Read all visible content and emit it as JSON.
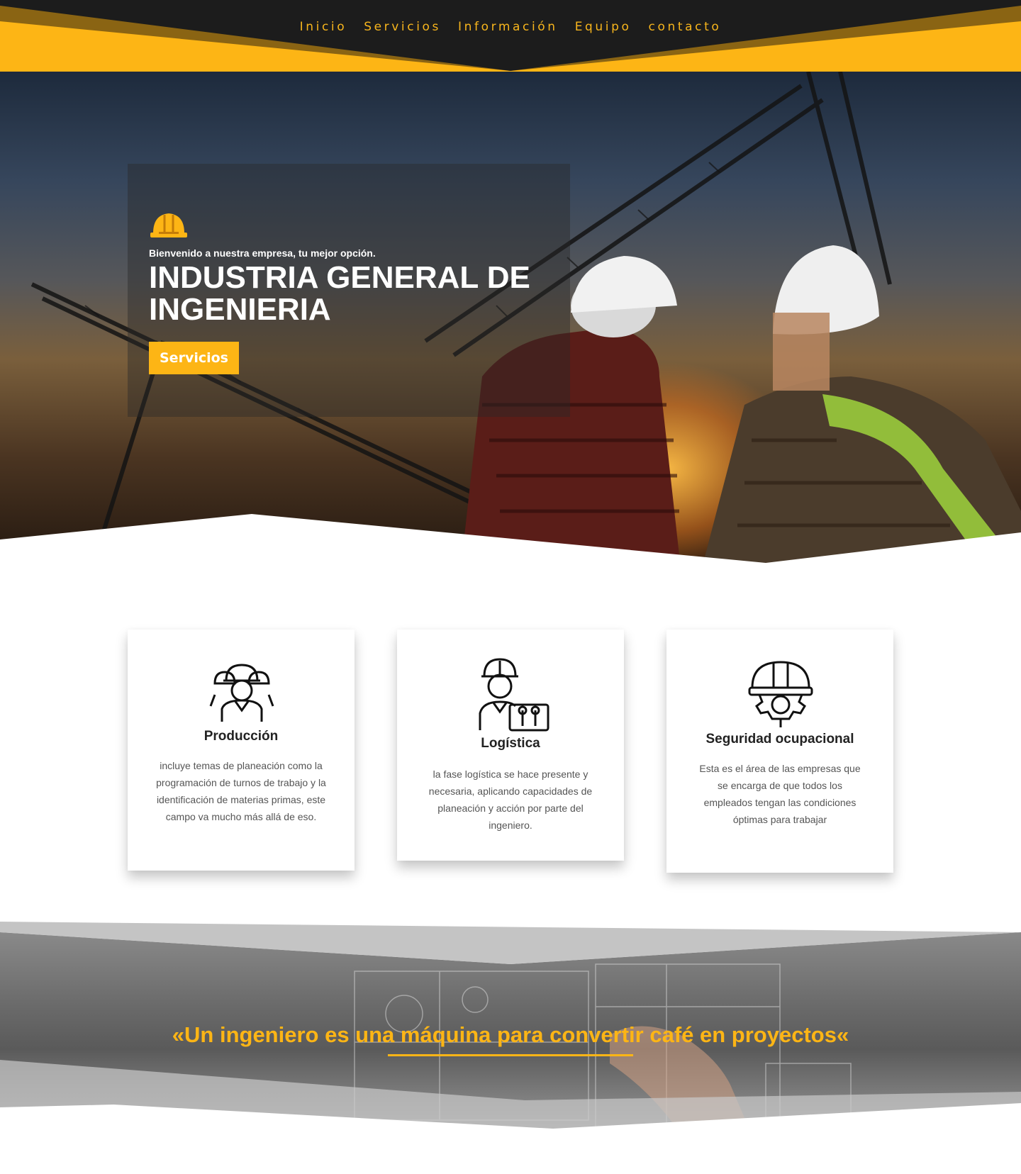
{
  "nav": {
    "items": [
      "Inicio",
      "Servicios",
      "Información",
      "Equipo",
      "contacto"
    ]
  },
  "hero": {
    "icon": "hard-hat-icon",
    "kicker": "Bienvenido a nuestra empresa, tu mejor opción.",
    "title": "INDUSTRIA GENERAL DE INGENIERIA",
    "button_label": "Servicios"
  },
  "services": [
    {
      "icon": "workers-group-icon",
      "title": "Producción",
      "text": "incluye temas de planeación como la programación de turnos de trabajo y la identificación de materias primas, este campo va mucho más allá de eso."
    },
    {
      "icon": "engineer-with-tools-icon",
      "title": "Logística",
      "text": "la fase logística se hace presente y necesaria, aplicando capacidades de planeación y acción por parte del ingeniero."
    },
    {
      "icon": "safety-helmet-gear-icon",
      "title": "Seguridad ocupacional",
      "text": "Esta es el área de las empresas que se encarga de que todos los empleados tengan las condiciones óptimas para trabajar"
    }
  ],
  "quote": {
    "text": "«Un ingeniero es una máquina para convertir café en proyectos«"
  },
  "colors": {
    "accent": "#fdb515",
    "dark": "#1c1c1c",
    "white": "#ffffff"
  }
}
